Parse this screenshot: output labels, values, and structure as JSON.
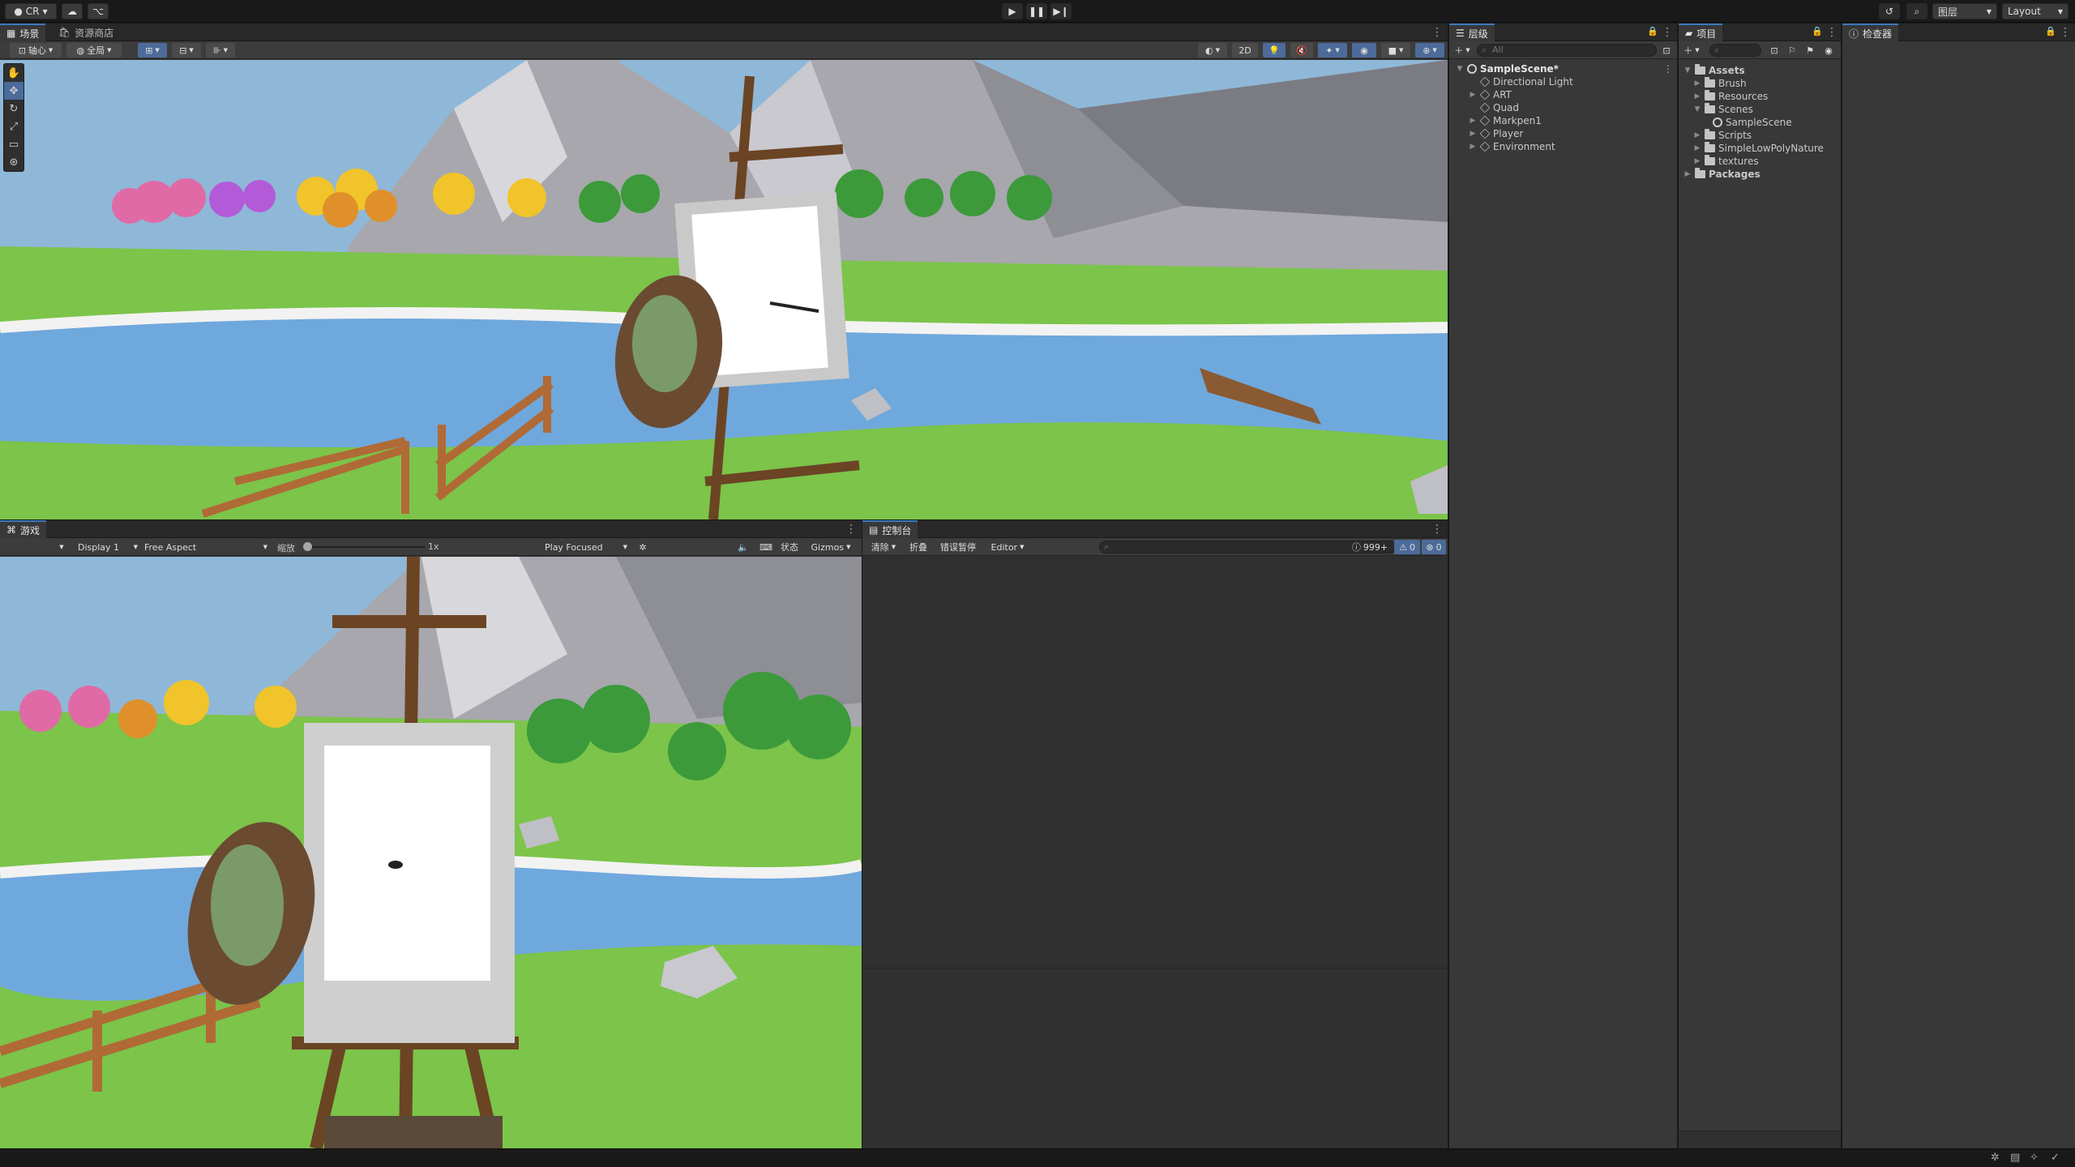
{
  "topbar": {
    "account": "CR",
    "layout": "Layout",
    "layers": "图层"
  },
  "scene_panel": {
    "tab_scene": "场景",
    "tab_store": "资源商店",
    "pivot": "轴心",
    "global": "全局",
    "mode_2d": "2D"
  },
  "game_panel": {
    "tab": "游戏",
    "display": "Display 1",
    "aspect": "Free Aspect",
    "scale_label": "缩放",
    "scale_value": "1x",
    "play_mode": "Play Focused",
    "stats": "状态",
    "gizmos": "Gizmos"
  },
  "console_panel": {
    "tab": "控制台",
    "clear": "清除",
    "collapse": "折叠",
    "error_pause": "错误暂停",
    "editor": "Editor",
    "count_log": "999+",
    "count_warn": "0",
    "count_error": "0"
  },
  "hierarchy": {
    "tab": "层级",
    "search_placeholder": "All",
    "scene": "SampleScene*",
    "items": [
      "Directional Light",
      "ART",
      "Quad",
      "Markpen1",
      "Player",
      "Environment"
    ]
  },
  "project": {
    "tab": "项目",
    "assets": "Assets",
    "folders": [
      "Brush",
      "Resources",
      "Scenes",
      "SampleScene",
      "Scripts",
      "SimpleLowPolyNature",
      "textures"
    ],
    "packages": "Packages"
  },
  "inspector": {
    "tab": "检查器"
  },
  "colors": {
    "accent": "#3a79bb",
    "panel": "#383838",
    "sky": "#8fb8d8",
    "grass": "#7cc44a",
    "river": "#6fa8dc"
  }
}
